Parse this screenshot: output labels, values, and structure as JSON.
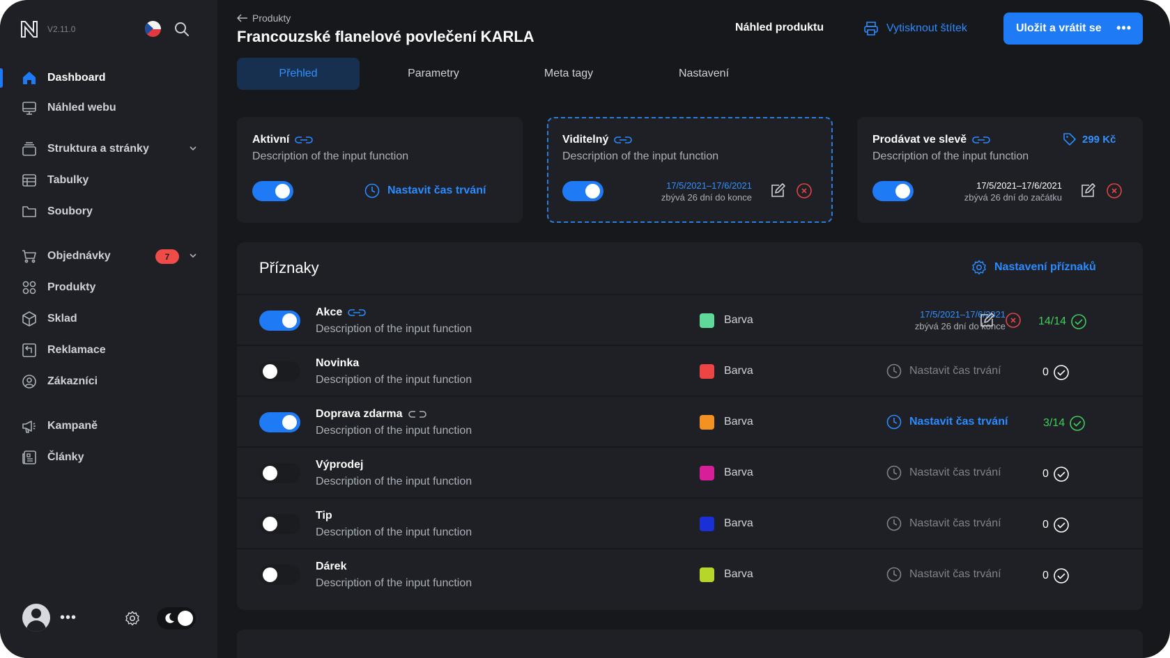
{
  "app": {
    "version": "V2.11.0",
    "language_icon": "czech-flag-icon"
  },
  "sidebar": {
    "items": [
      {
        "label": "Dashboard",
        "icon": "home-icon",
        "active": true
      },
      {
        "label": "Náhled webu",
        "icon": "monitor-icon"
      },
      {
        "label": "Struktura a stránky",
        "icon": "layers-icon",
        "expandable": true
      },
      {
        "label": "Tabulky",
        "icon": "table-icon"
      },
      {
        "label": "Soubory",
        "icon": "folder-icon"
      },
      {
        "label": "Objednávky",
        "icon": "cart-icon",
        "badge": "7",
        "expandable": true
      },
      {
        "label": "Produkty",
        "icon": "grid-icon"
      },
      {
        "label": "Sklad",
        "icon": "box-icon"
      },
      {
        "label": "Reklamace",
        "icon": "return-icon"
      },
      {
        "label": "Zákazníci",
        "icon": "user-circle-icon"
      },
      {
        "label": "Kampaně",
        "icon": "megaphone-icon"
      },
      {
        "label": "Články",
        "icon": "article-icon"
      }
    ],
    "more_label": "•••"
  },
  "header": {
    "breadcrumb": "Produkty",
    "title": "Francouzské flanelové povlečení KARLA",
    "preview_label": "Náhled produktu",
    "print_label": "Vytisknout štítek",
    "save_label": "Uložit a vrátit se",
    "save_more": "•••"
  },
  "tabs": [
    {
      "label": "Přehled",
      "active": true
    },
    {
      "label": "Parametry"
    },
    {
      "label": "Meta tagy"
    },
    {
      "label": "Nastavení"
    }
  ],
  "cards": [
    {
      "title": "Aktivní",
      "description": "Description of the input function",
      "enabled": true,
      "action_label": "Nastavit čas trvání"
    },
    {
      "title": "Viditelný",
      "description": "Description of the input function",
      "enabled": true,
      "date_range": "17/5/2021–17/6/2021",
      "remaining": "zbývá 26 dní do konce"
    },
    {
      "title": "Prodávat ve slevě",
      "description": "Description of the input function",
      "enabled": true,
      "price": "299 Kč",
      "date_range": "17/5/2021–17/6/2021",
      "remaining": "zbývá 26 dní do začátku"
    }
  ],
  "flags": {
    "title": "Příznaky",
    "settings_label": "Nastavení příznaků",
    "color_label": "Barva",
    "set_duration_label": "Nastavit čas trvání",
    "rows": [
      {
        "name": "Akce",
        "description": "Description of the input function",
        "enabled": true,
        "linked": true,
        "color": "#5fd89a",
        "date_range": "17/5/2021–17/6/2021",
        "remaining": "zbývá 26 dní do konce",
        "count": "14/14",
        "count_color": "#3fcf5a"
      },
      {
        "name": "Novinka",
        "description": "Description of the input function",
        "enabled": false,
        "color": "#ee4444",
        "count": "0",
        "count_color": "#ffffff"
      },
      {
        "name": "Doprava zdarma",
        "description": "Description of the input function",
        "enabled": true,
        "unlinked": true,
        "color": "#f39222",
        "count": "3/14",
        "count_color": "#3fcf5a",
        "duration_highlight": true
      },
      {
        "name": "Výprodej",
        "description": "Description of the input function",
        "enabled": false,
        "color": "#d91e99",
        "count": "0",
        "count_color": "#ffffff"
      },
      {
        "name": "Tip",
        "description": "Description of the input function",
        "enabled": false,
        "color": "#1b2fd6",
        "count": "0",
        "count_color": "#ffffff"
      },
      {
        "name": "Dárek",
        "description": "Description of the input function",
        "enabled": false,
        "color": "#b6d72a",
        "count": "0",
        "count_color": "#ffffff"
      }
    ]
  },
  "colors": {
    "accent": "#1e7bf5",
    "success": "#3fcf5a",
    "danger": "#ee4b49"
  }
}
